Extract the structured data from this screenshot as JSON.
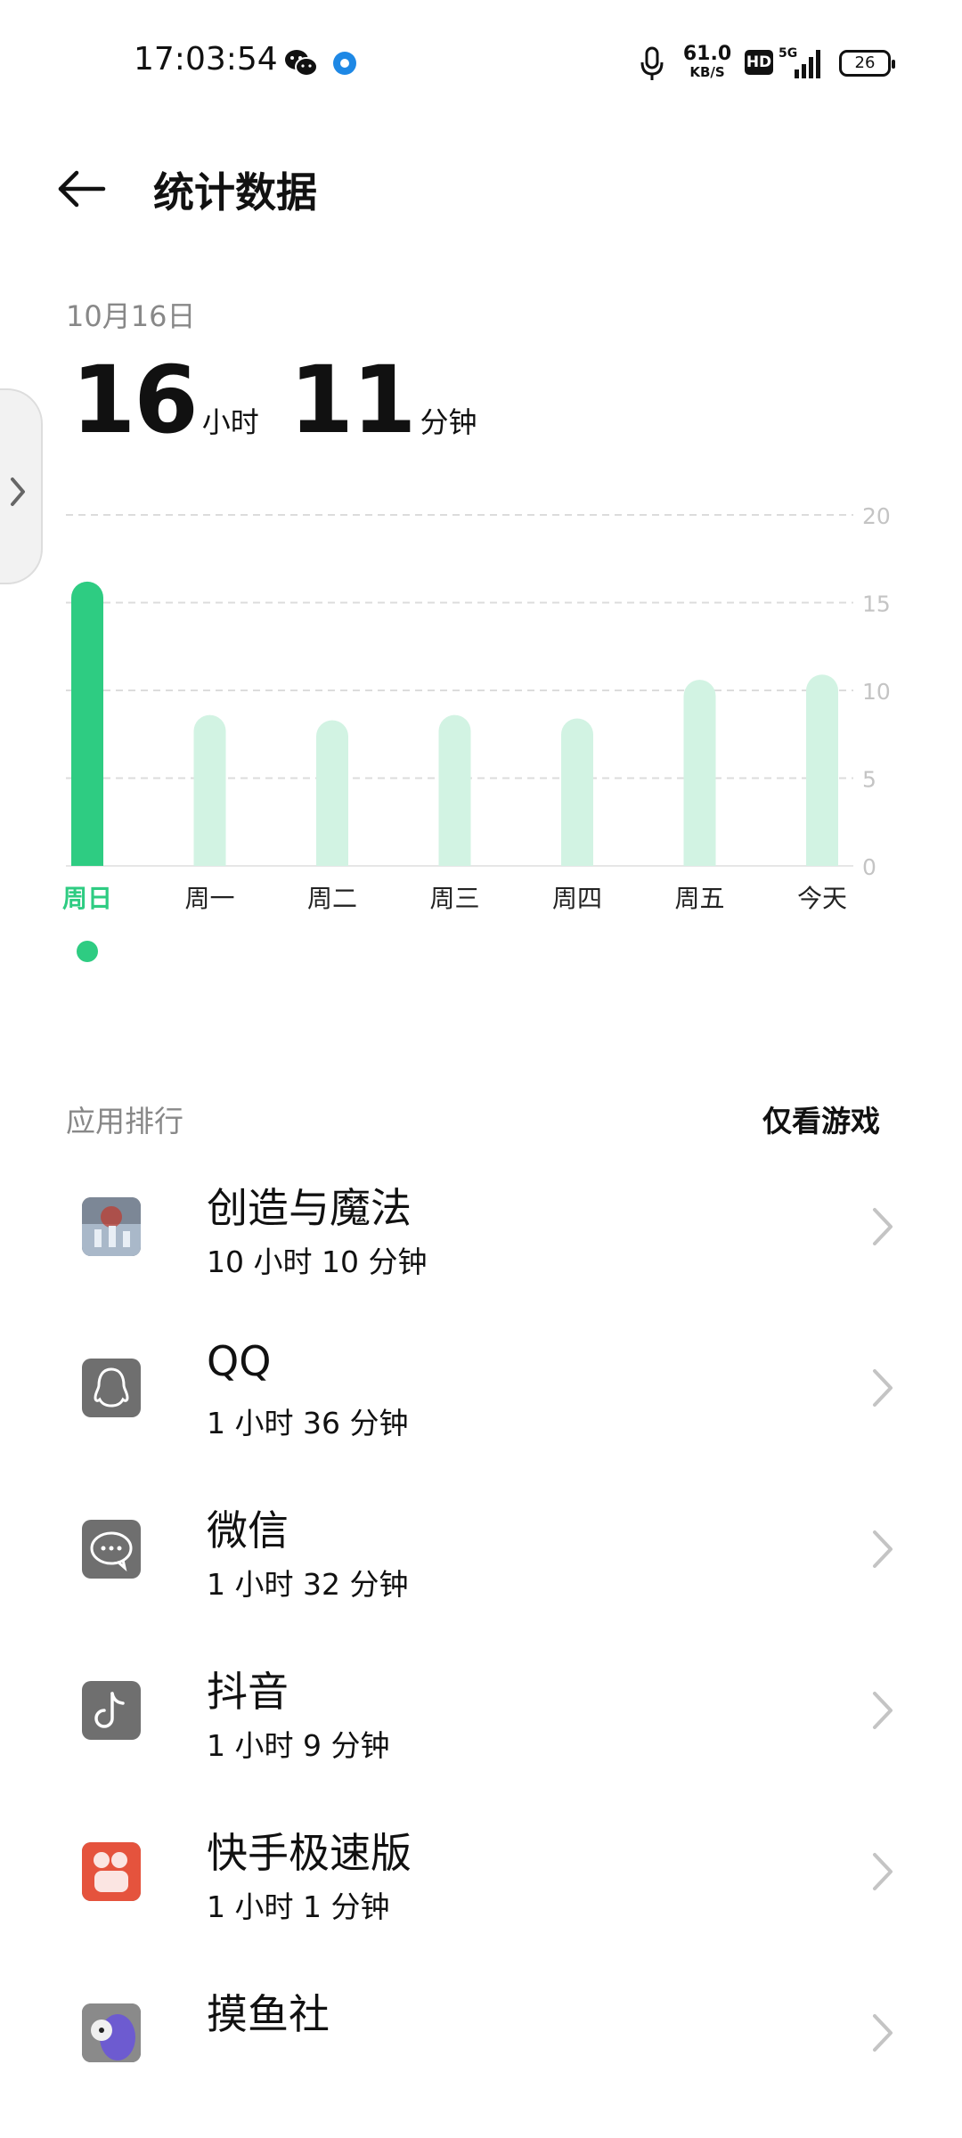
{
  "status_bar": {
    "time": "17:03:54",
    "net_speed_value": "61.0",
    "net_speed_unit": "KB/S",
    "hd_badge": "HD",
    "network": "5G",
    "battery": "26",
    "icons": [
      "wechat-icon",
      "circle-notify-icon",
      "mic-icon",
      "signal-icon",
      "battery-icon"
    ]
  },
  "header": {
    "title": "统计数据"
  },
  "summary": {
    "date": "10月16日",
    "hours": "16",
    "hours_unit": "小时",
    "minutes": "11",
    "minutes_unit": "分钟"
  },
  "colors": {
    "accent": "#2ecc82",
    "bar_inactive": "#d2f3e3",
    "muted": "#888888"
  },
  "chart_data": {
    "type": "bar",
    "categories": [
      "周日",
      "周一",
      "周二",
      "周三",
      "周四",
      "周五",
      "今天"
    ],
    "values": [
      16.2,
      8.6,
      8.3,
      8.6,
      8.4,
      10.6,
      10.9
    ],
    "selected_index": 0,
    "ylim": [
      0,
      20
    ],
    "yticks": [
      "0",
      "5",
      "10",
      "15",
      "20"
    ],
    "ytick_values": [
      0,
      5,
      10,
      15,
      20
    ],
    "grid": true,
    "xlabel": "",
    "ylabel": "",
    "title": ""
  },
  "ranking": {
    "title": "应用排行",
    "filter_label": "仅看游戏",
    "apps": [
      {
        "name": "创造与魔法",
        "time": "10 小时 10 分钟",
        "icon": "game-icon"
      },
      {
        "name": "QQ",
        "time": "1 小时 36 分钟",
        "icon": "qq-icon"
      },
      {
        "name": "微信",
        "time": "1 小时 32 分钟",
        "icon": "wechat-icon"
      },
      {
        "name": "抖音",
        "time": "1 小时 9 分钟",
        "icon": "tiktok-icon"
      },
      {
        "name": "快手极速版",
        "time": "1 小时 1 分钟",
        "icon": "kuaishou-icon"
      },
      {
        "name": "摸鱼社",
        "time": "",
        "icon": "moyushe-icon"
      }
    ]
  }
}
